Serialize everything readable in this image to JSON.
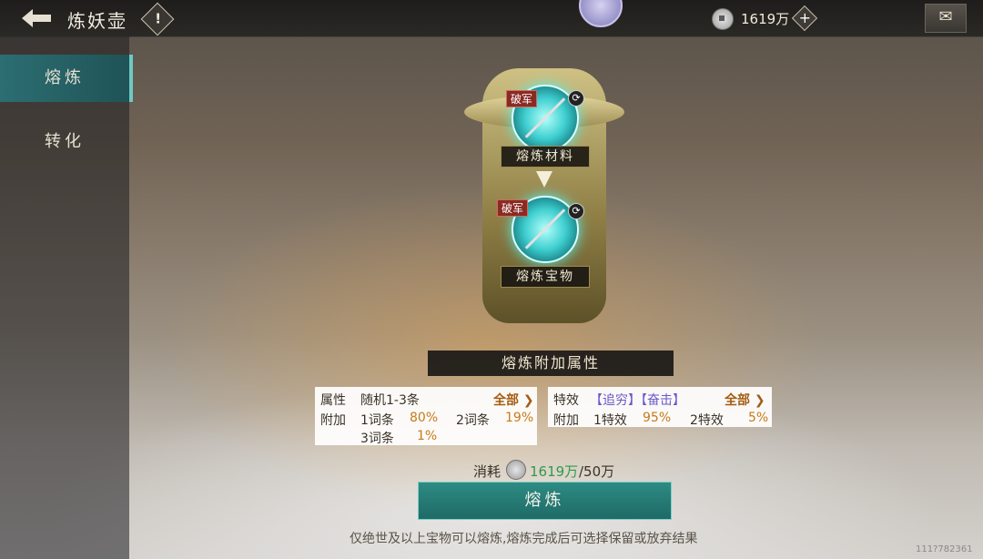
{
  "header": {
    "title": "炼妖壶",
    "info_symbol": "!",
    "currency_amount": "1619万",
    "plus_symbol": "+",
    "mail_symbol": "✉"
  },
  "sidebar": {
    "tabs": [
      {
        "label": "熔炼",
        "active": true
      },
      {
        "label": "转化",
        "active": false
      }
    ]
  },
  "vessel": {
    "material_tag": "破军",
    "material_label": "熔炼材料",
    "treasure_tag": "破军",
    "treasure_label": "熔炼宝物"
  },
  "attributes": {
    "header": "熔炼附加属性",
    "left": {
      "title": "属性",
      "value": "随机1-3条",
      "more": "全部",
      "row_label": "附加",
      "items": [
        {
          "name": "1词条",
          "pct": "80%"
        },
        {
          "name": "2词条",
          "pct": "19%"
        },
        {
          "name": "3词条",
          "pct": "1%"
        }
      ]
    },
    "right": {
      "title": "特效",
      "value": "【追穷】【奋击】",
      "more": "全部",
      "row_label": "附加",
      "items": [
        {
          "name": "1特效",
          "pct": "95%"
        },
        {
          "name": "2特效",
          "pct": "5%"
        }
      ]
    }
  },
  "cost": {
    "label": "消耗",
    "have": "1619万",
    "need": "/50万"
  },
  "button_label": "熔炼",
  "hint": "仅绝世及以上宝物可以熔炼,熔炼完成后可选择保留或放弃结果",
  "uid": "111?782361"
}
